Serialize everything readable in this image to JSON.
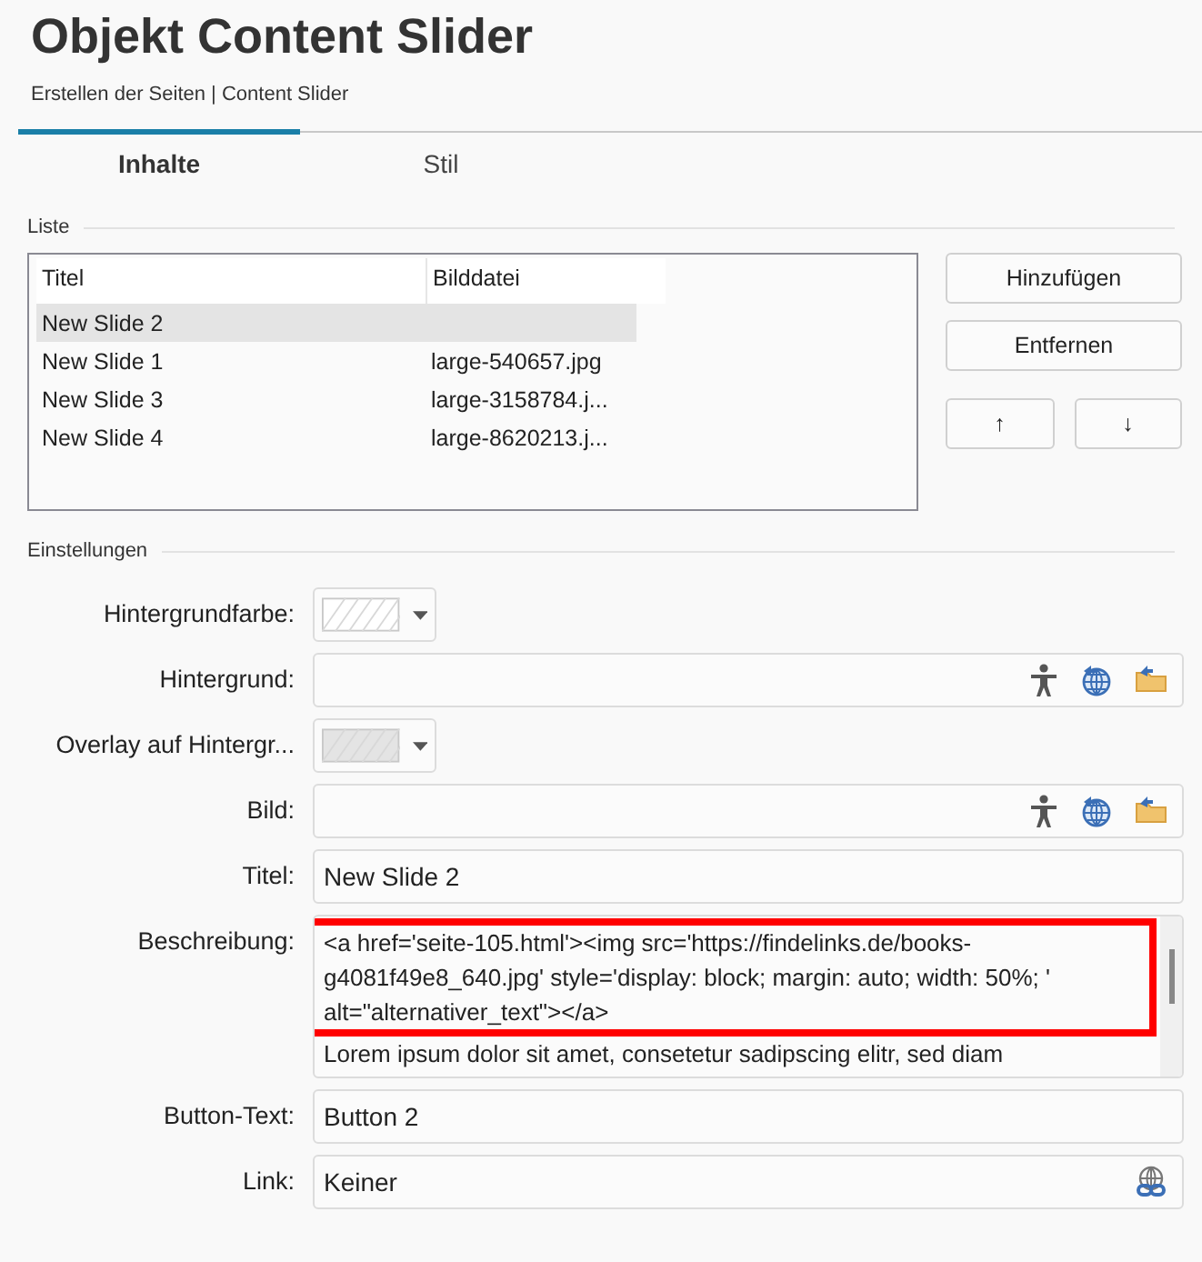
{
  "title": "Objekt Content Slider",
  "breadcrumb": "Erstellen der Seiten | Content Slider",
  "tabs": [
    {
      "label": "Inhalte",
      "selected": true
    },
    {
      "label": "Stil",
      "selected": false
    }
  ],
  "list_section": {
    "legend": "Liste",
    "columns": [
      "Titel",
      "Bilddatei"
    ],
    "rows": [
      {
        "title": "New Slide 2",
        "selected": true
      },
      {
        "title": "New Slide 1",
        "file": "large-540657.jpg",
        "selected": false
      },
      {
        "title": "New Slide 3",
        "file": "large-3158784.j...",
        "selected": false
      },
      {
        "title": "New Slide 4",
        "file": "large-8620213.j...",
        "selected": false
      }
    ],
    "buttons": [
      "Hinzufügen",
      "Entfernen"
    ],
    "move_buttons": [
      "↑",
      "↓"
    ]
  },
  "settings": {
    "legend": "Einstellungen",
    "fields": [
      {
        "kind": "color",
        "label": "Hintergrundfarbe:",
        "disabled": false
      },
      {
        "kind": "file",
        "label": "Hintergrund:"
      },
      {
        "kind": "color",
        "label": "Overlay auf Hintergr...",
        "disabled": true
      },
      {
        "kind": "file",
        "label": "Bild:"
      },
      {
        "kind": "text",
        "label": "Titel:",
        "value": "New Slide 2"
      },
      {
        "kind": "textarea",
        "label": "Beschreibung:",
        "highlighted": true,
        "paragraphs": [
          "<a href='seite-105.html'><img src='https://findelinks.de/books-g4081f49e8_640.jpg' style='display: block; margin: auto; width: 50%; ' alt=\"alternativer_text\"></a>",
          "Lorem ipsum dolor sit amet, consetetur sadipscing elitr, sed diam"
        ]
      },
      {
        "kind": "text",
        "label": "Button-Text:",
        "value": "Button 2"
      },
      {
        "kind": "link",
        "label": "Link:",
        "value": "Keiner"
      }
    ]
  }
}
